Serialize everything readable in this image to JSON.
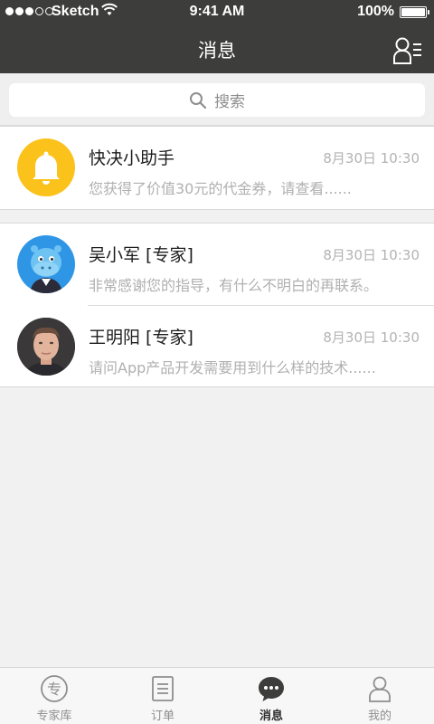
{
  "status_bar": {
    "carrier": "Sketch",
    "time": "9:41 AM",
    "battery": "100%"
  },
  "nav": {
    "title": "消息"
  },
  "search": {
    "placeholder": "搜索"
  },
  "messages": [
    {
      "name": "快决小助手",
      "time": "8月30日 10:30",
      "preview": "您获得了价值30元的代金券，请查看......",
      "avatar_icon": "bell-icon",
      "avatar_color": "#fbc21b"
    },
    {
      "name": "吴小军 [专家]",
      "time": "8月30日 10:30",
      "preview": "非常感谢您的指导，有什么不明白的再联系。",
      "avatar_icon": "hippo-avatar",
      "avatar_color": "#2f96e6"
    },
    {
      "name": "王明阳 [专家]",
      "time": "8月30日 10:30",
      "preview": "请问App产品开发需要用到什么样的技术......",
      "avatar_icon": "person-photo-avatar",
      "avatar_color": "#3a3838"
    }
  ],
  "tabs": [
    {
      "label": "专家库",
      "icon": "expert-icon",
      "active": false
    },
    {
      "label": "订单",
      "icon": "order-list-icon",
      "active": false
    },
    {
      "label": "消息",
      "icon": "chat-bubble-icon",
      "active": true
    },
    {
      "label": "我的",
      "icon": "user-icon",
      "active": false
    }
  ],
  "colors": {
    "header_bg": "#3d3d3b",
    "page_bg": "#f1f1f1",
    "notice_yellow": "#fbc21b",
    "muted_text": "#b0b0b0"
  }
}
